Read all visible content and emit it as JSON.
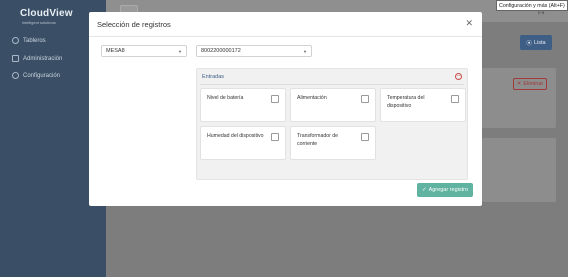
{
  "app": {
    "logo": "CloudView",
    "logo_sub": "intelligent solutions"
  },
  "sidebar": {
    "items": [
      {
        "label": "Tableros",
        "icon": "dashboard-icon"
      },
      {
        "label": "Administración",
        "icon": "monitor-icon"
      },
      {
        "label": "Configuración",
        "icon": "gear-icon"
      }
    ]
  },
  "header": {
    "tooltip": "Configuración y más (Alt+F)"
  },
  "background": {
    "lista_label": "Lista",
    "eliminar_label": "Eliminar"
  },
  "modal": {
    "title": "Selección de registros",
    "close_icon": "close-icon",
    "select1_value": "MESA8",
    "select2_value": "8002200000172",
    "panel_title": "Entradas",
    "options": [
      {
        "label": "Nivel de batería",
        "checked": false
      },
      {
        "label": "Alimentación",
        "checked": false
      },
      {
        "label": "Temperatura del dispositivo",
        "checked": false
      },
      {
        "label": "Humedad del dispositivo",
        "checked": false
      },
      {
        "label": "Transformador de corriente",
        "checked": false
      }
    ],
    "add_button": "Agregar registro"
  },
  "colors": {
    "sidebar": "#3a4f66",
    "accent_blue": "#3f5e86",
    "add_green": "#5fb3a0",
    "danger": "#c94a4a"
  }
}
